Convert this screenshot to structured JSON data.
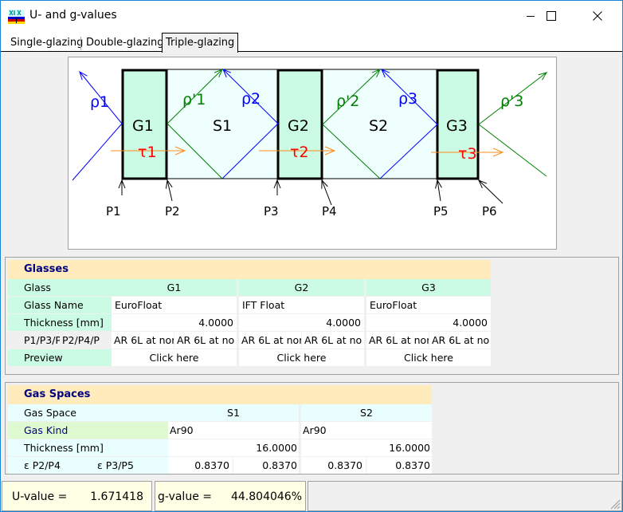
{
  "window": {
    "title": "U- and g-values",
    "icon": "glazing-app-icon",
    "controls": {
      "minimize": "minimize-icon",
      "maximize": "maximize-icon",
      "close": "close-icon"
    }
  },
  "tabs": [
    {
      "label": "Single-glazing",
      "active": false
    },
    {
      "label": "Double-glazing",
      "active": false
    },
    {
      "label": "Triple-glazing",
      "active": true
    }
  ],
  "diagram": {
    "glasses": [
      "G1",
      "G2",
      "G3"
    ],
    "spaces": [
      "S1",
      "S2"
    ],
    "reflection_front": [
      "ρ1",
      "ρ2",
      "ρ3"
    ],
    "reflection_back": [
      "ρ'1",
      "ρ'2",
      "ρ'3"
    ],
    "transmission": [
      "τ1",
      "τ2",
      "τ3"
    ],
    "positions": [
      "P1",
      "P2",
      "P3",
      "P4",
      "P5",
      "P6"
    ],
    "colors": {
      "glass_fill": "#ccfbe5",
      "space_fill": "#effffe",
      "reflection_front": "#0000ff",
      "reflection_back": "#008000",
      "transmission_arrow": "#ff8c1a",
      "transmission_label": "#ff0000"
    }
  },
  "glasses": {
    "title": "Glasses",
    "row_labels": {
      "glass": "Glass",
      "name": "Glass Name",
      "thickness": "Thickness [mm]",
      "coating_front": "P1/P3/P",
      "coating_back": "P2/P4/P",
      "preview": "Preview"
    },
    "columns": [
      {
        "glass": "G1",
        "name": "EuroFloat",
        "thickness": "4.0000",
        "coating_front": "AR 6L at nor",
        "coating_back": "AR 6L at no",
        "preview": "Click here"
      },
      {
        "glass": "G2",
        "name": "IFT Float",
        "thickness": "4.0000",
        "coating_front": "AR 6L at nor",
        "coating_back": "AR 6L at no",
        "preview": "Click here"
      },
      {
        "glass": "G3",
        "name": "EuroFloat",
        "thickness": "4.0000",
        "coating_front": "AR 6L at nor",
        "coating_back": "AR 6L at no",
        "preview": "Click here"
      }
    ]
  },
  "gas_spaces": {
    "title": "Gas Spaces",
    "row_labels": {
      "space": "Gas Space",
      "kind": "Gas Kind",
      "thickness": "Thickness [mm]",
      "eps_left": "ε P2/P4",
      "eps_right": "ε P3/P5"
    },
    "columns": [
      {
        "space": "S1",
        "kind": "Ar90",
        "thickness": "16.0000",
        "eps_left": "0.8370",
        "eps_right": "0.8370"
      },
      {
        "space": "S2",
        "kind": "Ar90",
        "thickness": "16.0000",
        "eps_left": "0.8370",
        "eps_right": "0.8370"
      }
    ]
  },
  "status": {
    "u_label": "U-value =",
    "u_value": "1.671418",
    "g_label": "g-value =",
    "g_value": "44.804046%"
  }
}
